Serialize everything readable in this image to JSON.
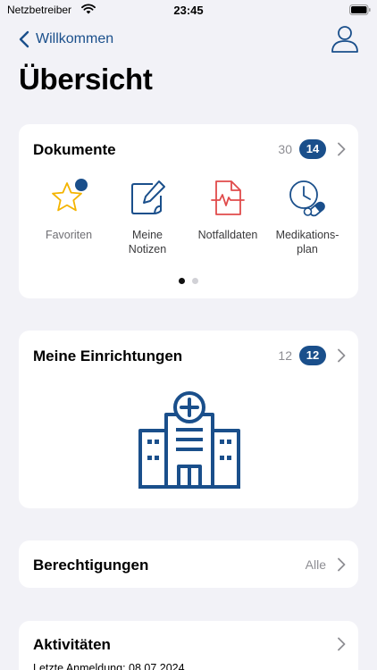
{
  "status_bar": {
    "carrier": "Netzbetreiber",
    "time": "23:45"
  },
  "nav": {
    "back_label": "Willkommen"
  },
  "page": {
    "title": "Übersicht"
  },
  "documents": {
    "title": "Dokumente",
    "total_count": "30",
    "new_count": "14",
    "items": [
      {
        "label": "Favoriten",
        "icon": "star-icon"
      },
      {
        "label": "Meine Notizen",
        "icon": "note-edit-icon"
      },
      {
        "label": "Notfalldaten",
        "icon": "emergency-document-icon"
      },
      {
        "label": "Medikations-plan",
        "icon": "medication-plan-icon"
      }
    ],
    "pagination": {
      "pages": 2,
      "current": 1
    }
  },
  "facilities": {
    "title": "Meine Einrichtungen",
    "total_count": "12",
    "new_count": "12",
    "icon": "hospital-icon"
  },
  "permissions": {
    "title": "Berechtigungen",
    "value": "Alle"
  },
  "activities": {
    "title": "Aktivitäten",
    "last_login": "Letzte Anmeldung: 08.07.2024"
  },
  "colors": {
    "accent": "#1a4f8b",
    "emergency": "#e04b4b",
    "favorite": "#f4b400",
    "background": "#f2f2f7"
  }
}
